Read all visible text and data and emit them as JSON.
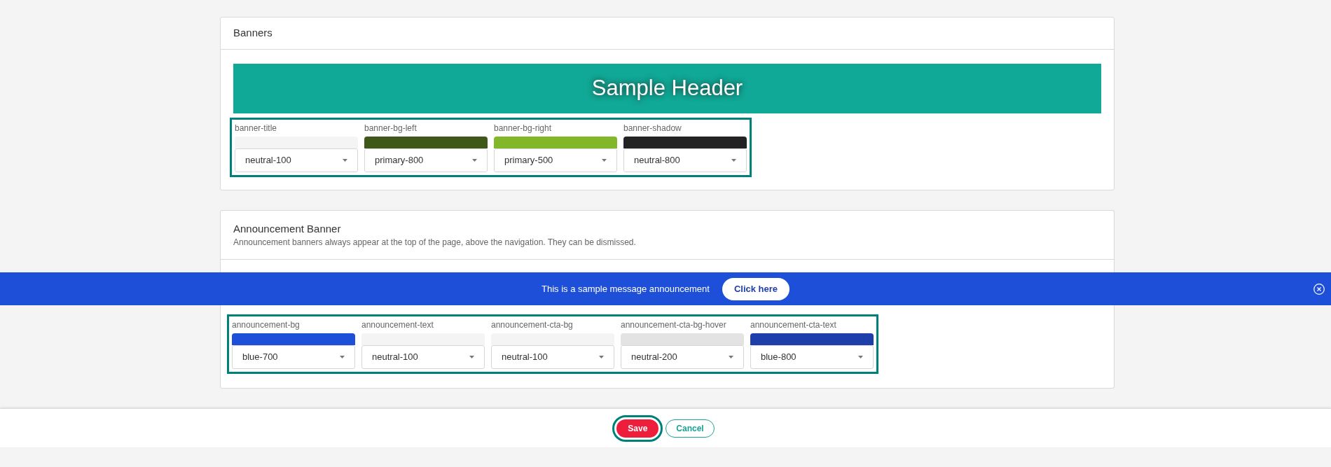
{
  "banners": {
    "title": "Banners",
    "preview": {
      "text": "Sample Header"
    },
    "swatch_group_highlighted": true,
    "swatches": [
      {
        "label": "banner-title",
        "color": "#f4f4f4",
        "value": "neutral-100"
      },
      {
        "label": "banner-bg-left",
        "color": "#3f5819",
        "value": "primary-800"
      },
      {
        "label": "banner-bg-right",
        "color": "#82b72a",
        "value": "primary-500"
      },
      {
        "label": "banner-shadow",
        "color": "#232323",
        "value": "neutral-800"
      }
    ]
  },
  "announcement": {
    "title": "Announcement Banner",
    "description": "Announcement banners always appear at the top of the page, above the navigation. They can be dismissed.",
    "preview": {
      "message": "This is a sample message announcement",
      "cta": "Click here"
    },
    "swatch_group_highlighted": true,
    "swatches": [
      {
        "label": "announcement-bg",
        "color": "#1e4fd8",
        "value": "blue-700"
      },
      {
        "label": "announcement-text",
        "color": "#f4f4f4",
        "value": "neutral-100"
      },
      {
        "label": "announcement-cta-bg",
        "color": "#f4f4f4",
        "value": "neutral-100"
      },
      {
        "label": "announcement-cta-bg-hover",
        "color": "#e3e3e3",
        "value": "neutral-200"
      },
      {
        "label": "announcement-cta-text",
        "color": "#1e3fa9",
        "value": "blue-800"
      }
    ]
  },
  "footer": {
    "buttons": [
      {
        "label": "Save",
        "kind": "primary",
        "focused": true
      },
      {
        "label": "Cancel",
        "kind": "secondary",
        "focused": false
      }
    ]
  }
}
